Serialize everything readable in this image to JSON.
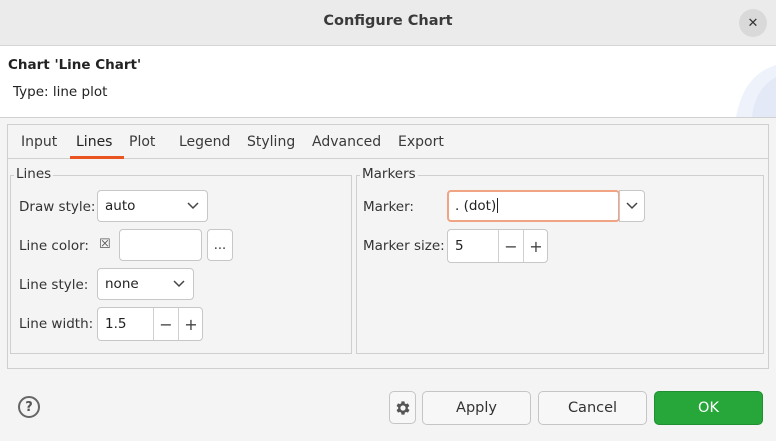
{
  "dialog": {
    "title": "Configure Chart",
    "close_icon": "close-icon"
  },
  "header": {
    "chart_name": "Chart 'Line Chart'",
    "chart_type": "Type: line plot"
  },
  "tabs": [
    {
      "label": "Input",
      "active": false
    },
    {
      "label": "Lines",
      "active": true
    },
    {
      "label": "Plot",
      "active": false
    },
    {
      "label": "Legend",
      "active": false
    },
    {
      "label": "Styling",
      "active": false
    },
    {
      "label": "Advanced",
      "active": false
    },
    {
      "label": "Export",
      "active": false
    }
  ],
  "lines_group": {
    "title": "Lines",
    "draw_style": {
      "label": "Draw style:",
      "value": "auto"
    },
    "line_color": {
      "label": "Line color:",
      "enabled_icon": "checkbox-x-icon",
      "value": "",
      "button_label": "..."
    },
    "line_style": {
      "label": "Line style:",
      "value": "none"
    },
    "line_width": {
      "label": "Line width:",
      "value": "1.5"
    }
  },
  "markers_group": {
    "title": "Markers",
    "marker": {
      "label": "Marker:",
      "value": ". (dot)"
    },
    "marker_size": {
      "label": "Marker size:",
      "value": "5"
    }
  },
  "spin_labels": {
    "minus": "−",
    "plus": "+"
  },
  "footer": {
    "help_icon": "help-icon",
    "settings_icon": "gear-icon",
    "apply_label": "Apply",
    "cancel_label": "Cancel",
    "ok_label": "OK"
  },
  "colors": {
    "accent": "#e95420",
    "ok_button": "#27a73a",
    "focus_border": "#f0a483"
  }
}
